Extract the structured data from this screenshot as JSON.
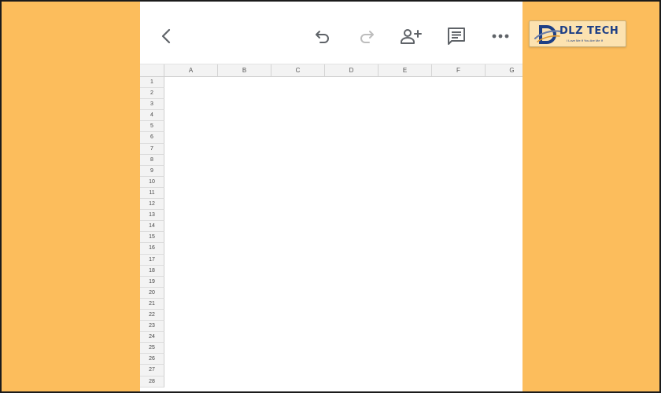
{
  "toolbar": {
    "icons": [
      "back-arrow-icon",
      "undo-icon",
      "redo-icon",
      "add-person-icon",
      "comment-icon",
      "more-options-icon"
    ]
  },
  "sheet": {
    "columns": [
      "A",
      "B",
      "C",
      "D",
      "E",
      "F",
      "G"
    ],
    "rows": [
      "1",
      "2",
      "3",
      "4",
      "5",
      "6",
      "7",
      "8",
      "9",
      "10",
      "11",
      "12",
      "13",
      "14",
      "15",
      "16",
      "17",
      "18",
      "19",
      "20",
      "21",
      "22",
      "23",
      "24",
      "25",
      "26",
      "27",
      "28"
    ]
  },
  "logo": {
    "name": "DLZ TECH",
    "tagline": "I Love Me If You Are Me If"
  },
  "colors": {
    "background": "#fcbd5c",
    "logo_text": "#1d3f86",
    "icon": "#5f6368",
    "icon_disabled": "#bdbdbd"
  }
}
